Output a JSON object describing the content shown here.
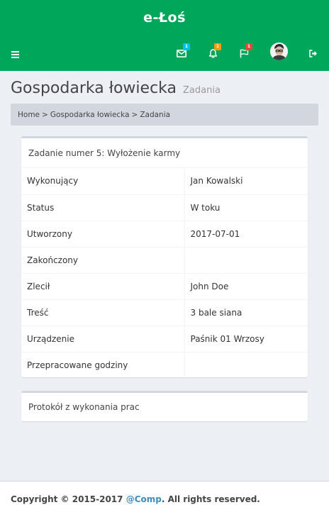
{
  "logo": {
    "text": "e-Łoś"
  },
  "navbar": {
    "toggle_icon": "bars-icon",
    "messages": {
      "icon": "envelope-icon",
      "count": "1",
      "color": "#00c0ef"
    },
    "notifications": {
      "icon": "bell-icon",
      "count": "1",
      "color": "#f39c12"
    },
    "tasks": {
      "icon": "flag-icon",
      "count": "1",
      "color": "#dd4b39"
    },
    "user": {
      "icon": "avatar"
    },
    "logout": {
      "icon": "sign-out-icon"
    }
  },
  "header": {
    "title": "Gospodarka łowiecka",
    "subtitle": "Zadania"
  },
  "breadcrumb": {
    "items": [
      "Home",
      "Gospodarka łowiecka",
      "Zadania"
    ],
    "separator": ">"
  },
  "task_box": {
    "title": "Zadanie numer 5: Wyłożenie karmy",
    "rows": [
      {
        "label": "Wykonujący",
        "value": "Jan Kowalski"
      },
      {
        "label": "Status",
        "value": "W toku"
      },
      {
        "label": "Utworzony",
        "value": "2017-07-01"
      },
      {
        "label": "Zakończony",
        "value": ""
      },
      {
        "label": "Zlecił",
        "value": "John Doe"
      },
      {
        "label": "Treść",
        "value": "3 bale siana"
      },
      {
        "label": "Urządzenie",
        "value": "Paśnik 01 Wrzosy"
      },
      {
        "label": "Przepracowane godziny",
        "value": ""
      }
    ]
  },
  "protocol_box": {
    "title": "Protokół z wykonania prac"
  },
  "footer": {
    "copyright": "Copyright © 2015-2017 ",
    "company_link": "@Comp",
    "rights": ". All rights reserved."
  },
  "colors": {
    "brand": "#00a65a",
    "link": "#3c8dbc"
  }
}
